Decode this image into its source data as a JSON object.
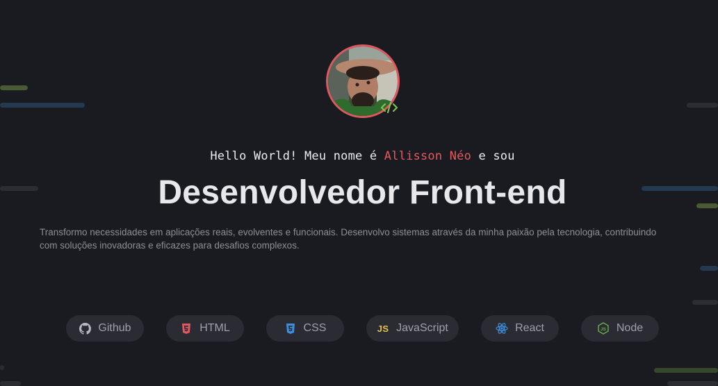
{
  "hero": {
    "hello_prefix": "Hello World! Meu nome é",
    "name": "Allisson Néo",
    "hello_suffix": "e sou",
    "title": "Desenvolvedor Front-end",
    "description": "Transformo necessidades em aplicações reais, evolventes e funcionais. Desenvolvo sistemas através da minha paixão pela tecnologia, contribuindo com soluções inovadoras e eficazes para desafios complexos."
  },
  "avatar": {
    "icon": "code-icon",
    "border_color": "#e0585f",
    "badge_color": "#7cc24e"
  },
  "colors": {
    "background": "#1a1b21",
    "accent": "#e9575e",
    "pill_bg": "#2a2b33",
    "pill_text": "#9fa0a8"
  },
  "techs": [
    {
      "label": "Github",
      "icon": "github-icon",
      "color": "#b8b9c0"
    },
    {
      "label": "HTML",
      "icon": "html5-icon",
      "color": "#e0585f"
    },
    {
      "label": "CSS",
      "icon": "css3-icon",
      "color": "#3d8fe0"
    },
    {
      "label": "JavaScript",
      "icon": "javascript-icon",
      "glyph": "JS",
      "color": "#e7c14c"
    },
    {
      "label": "React",
      "icon": "react-icon",
      "color": "#3d8fe0"
    },
    {
      "label": "Node",
      "icon": "nodejs-icon",
      "color": "#6aa84f"
    }
  ]
}
